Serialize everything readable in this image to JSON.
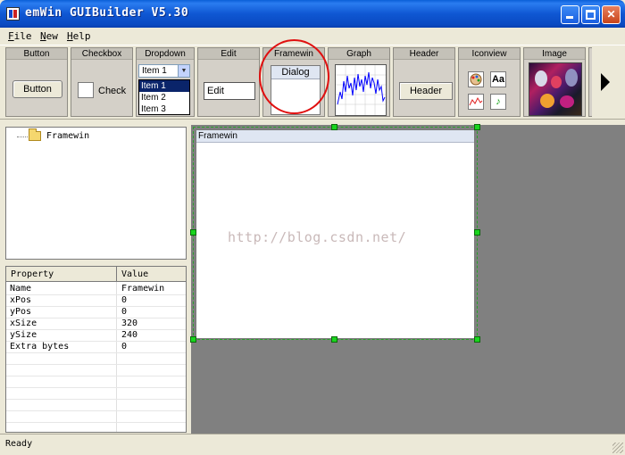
{
  "window": {
    "title": "emWin GUIBuilder V5.30",
    "minimize_icon": "minimize-icon",
    "maximize_icon": "maximize-icon",
    "close_glyph": "✕"
  },
  "menu": {
    "items": [
      "File",
      "New",
      "Help"
    ]
  },
  "toolbar": {
    "button": {
      "label": "Button",
      "sample": "Button"
    },
    "checkbox": {
      "label": "Checkbox",
      "sample": "Check"
    },
    "dropdown": {
      "label": "Dropdown",
      "selected": "Item 1",
      "options": [
        "Item 1",
        "Item 2",
        "Item 3"
      ],
      "highlighted": "Item 1"
    },
    "edit": {
      "label": "Edit",
      "sample": "Edit"
    },
    "framewin": {
      "label": "Framewin",
      "sample": "Dialog",
      "annotation": "red circle"
    },
    "graph": {
      "label": "Graph"
    },
    "header": {
      "label": "Header",
      "sample": "Header"
    },
    "iconview": {
      "label": "Iconview",
      "text_icon": "Aa",
      "icons": [
        "palette-icon",
        "text-icon",
        "chart-icon",
        "music-note-icon"
      ]
    },
    "image": {
      "label": "Image"
    },
    "scroll_right_icon": "arrow-right-icon"
  },
  "tree": {
    "items": [
      {
        "label": "Framewin",
        "icon": "folder-icon"
      }
    ]
  },
  "properties": {
    "headers": [
      "Property",
      "Value"
    ],
    "rows": [
      {
        "property": "Name",
        "value": "Framewin"
      },
      {
        "property": "xPos",
        "value": "0"
      },
      {
        "property": "yPos",
        "value": "0"
      },
      {
        "property": "xSize",
        "value": "320"
      },
      {
        "property": "ySize",
        "value": "240"
      },
      {
        "property": "Extra bytes",
        "value": "0"
      }
    ]
  },
  "workspace": {
    "framewin_title": "Framewin",
    "watermark": "http://blog.csdn.net/",
    "selection_color": "#19d41e"
  },
  "status": {
    "text": "Ready"
  },
  "colors": {
    "titlebar": "#0f57d3",
    "workspace": "#808080",
    "annotation": "#e01010",
    "dropdown_highlight": "#0a246a"
  }
}
